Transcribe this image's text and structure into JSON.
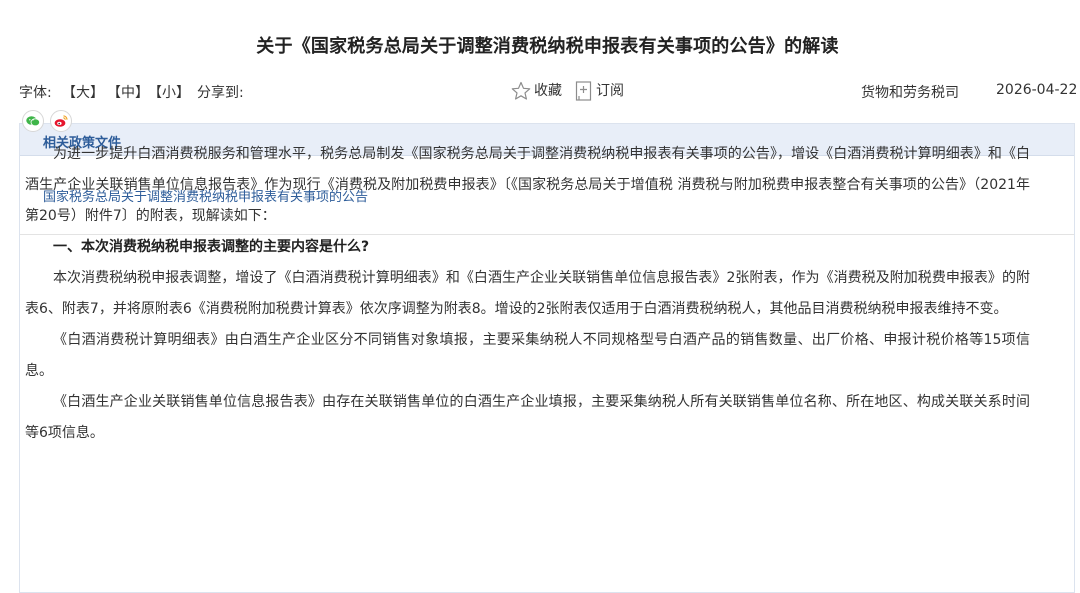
{
  "title": "关于《国家税务总局关于调整消费税纳税申报表有关事项的公告》的解读",
  "toolbar": {
    "font_label": "字体:",
    "size_large": "【大】",
    "size_medium": "【中】",
    "size_small": "【小】",
    "share_label": "分享到:",
    "favorite_label": "收藏",
    "subscribe_label": "订阅",
    "department": "货物和劳务税司",
    "date": "2026-04-22"
  },
  "share_icons": [
    "wechat-icon",
    "weibo-icon"
  ],
  "related": {
    "header": "相关政策文件",
    "link": "国家税务总局关于调整消费税纳税申报表有关事项的公告"
  },
  "body": {
    "p1": "为进一步提升白酒消费税服务和管理水平，税务总局制发《国家税务总局关于调整消费税纳税申报表有关事项的公告》，增设《白酒消费税计算明细表》和《白酒生产企业关联销售单位信息报告表》作为现行《消费税及附加税费申报表》〔《国家税务总局关于增值税 消费税与附加税费申报表整合有关事项的公告》（2021年第20号）附件7〕的附表，现解读如下：",
    "h1": "一、本次消费税纳税申报表调整的主要内容是什么?",
    "p2": "本次消费税纳税申报表调整，增设了《白酒消费税计算明细表》和《白酒生产企业关联销售单位信息报告表》2张附表，作为《消费税及附加税费申报表》的附表6、附表7，并将原附表6《消费税附加税费计算表》依次序调整为附表8。增设的2张附表仅适用于白酒消费税纳税人，其他品目消费税纳税申报表维持不变。",
    "p3": "《白酒消费税计算明细表》由白酒生产企业区分不同销售对象填报，主要采集纳税人不同规格型号白酒产品的销售数量、出厂价格、申报计税价格等15项信息。",
    "p4": "《白酒生产企业关联销售单位信息报告表》由存在关联销售单位的白酒生产企业填报，主要采集纳税人所有关联销售单位名称、所在地区、构成关联关系时间等6项信息。"
  },
  "colors": {
    "accent": "#2e5d9a",
    "header_bg": "#e8eef8",
    "wechat": "#3fb549",
    "weibo": "#e6162d"
  }
}
